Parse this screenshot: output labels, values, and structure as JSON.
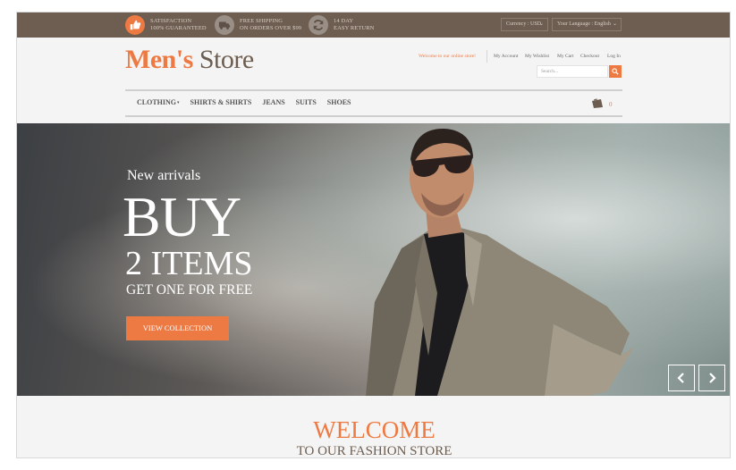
{
  "topbar": {
    "promos": [
      {
        "icon": "thumbs-up-icon",
        "line1": "SATISFACTION",
        "line2": "100% GUARANTEED"
      },
      {
        "icon": "truck-icon",
        "line1": "FREE SHIPPING",
        "line2": "ON ORDERS OVER $99"
      },
      {
        "icon": "refresh-icon",
        "line1": "14 DAY",
        "line2": "EASY RETURN"
      }
    ],
    "currency": "Currency : USD",
    "language": "Your Language : English"
  },
  "header": {
    "logo_part1": "Men's",
    "logo_part2": " Store",
    "welcome": "Welcome to our online store!",
    "links": [
      "My Account",
      "My Wishlist",
      "My Cart",
      "Checkout",
      "Log In"
    ],
    "search_placeholder": "Search..."
  },
  "nav": {
    "items": [
      "CLOTHING",
      "SHIRTS & SHIRTS",
      "JEANS",
      "SUITS",
      "SHOES"
    ],
    "cart_count": "0"
  },
  "hero": {
    "subtitle": "New arrivals",
    "headline": "BUY",
    "line2": "2 ITEMS",
    "line3": "GET ONE FOR FREE",
    "button": "VIEW COLLECTION"
  },
  "welcome": {
    "title": "WELCOME",
    "subtitle": "TO OUR FASHION STORE"
  },
  "colors": {
    "accent": "#ee7a43",
    "topbar": "#6d5e51"
  }
}
